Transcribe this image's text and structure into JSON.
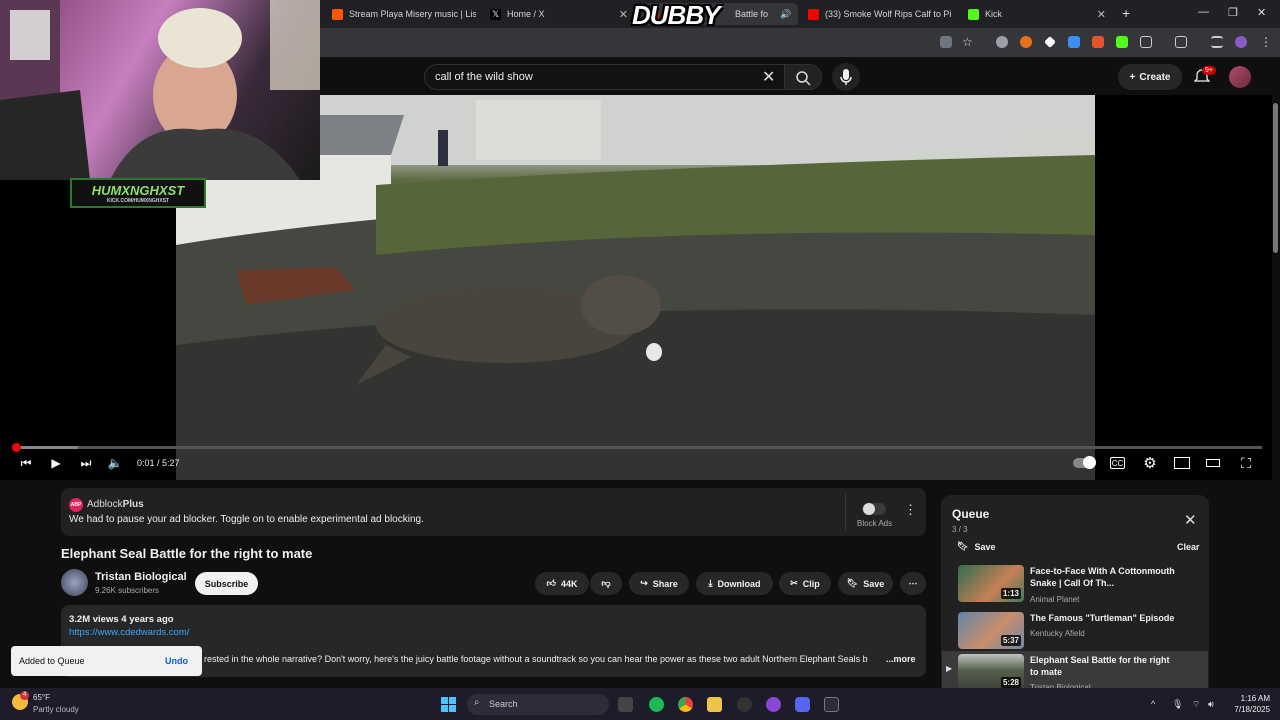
{
  "browser": {
    "tabs": [
      {
        "label": "Stream Playa Misery music | Lis",
        "favicon_color": "#ff5500",
        "active": false
      },
      {
        "label": "Home / X",
        "favicon_color": "#000000",
        "active": false
      },
      {
        "label": "Battle fo",
        "favicon_color": "#ff0000",
        "active": true
      },
      {
        "label": "(33) Smoke Wolf Rips Calf to Pi",
        "favicon_color": "#ff0000",
        "active": false
      },
      {
        "label": "Kick",
        "favicon_color": "#53fc18",
        "active": false
      }
    ],
    "new_tab": "+",
    "window_controls": {
      "minimize": "—",
      "restore": "❐",
      "close": "✕"
    }
  },
  "overlay": {
    "brand": "DUBBY",
    "streamer_tag": "HUMXNGHXST",
    "streamer_tag_sub": "KICK.COM/HUMXNGHXST"
  },
  "youtube": {
    "search_value": "call of the wild show",
    "create_label": "Create",
    "notif_badge": "9+",
    "player": {
      "time": "0:01 / 5:27",
      "progress_fraction": 0.003,
      "buffered_fraction": 0.053
    },
    "adblock": {
      "brand_prefix": "Adblock",
      "brand_suffix": "Plus",
      "logo": "ABP",
      "message": "We had to pause your ad blocker. Toggle on to enable experimental ad blocking.",
      "toggle_label": "Block Ads"
    },
    "video": {
      "title": "Elephant Seal Battle for the right to mate",
      "channel": "Tristan Biological",
      "subscribers": "9.26K subscribers",
      "subscribe_label": "Subscribe",
      "likes": "44K",
      "share_label": "Share",
      "download_label": "Download",
      "clip_label": "Clip",
      "save_label": "Save",
      "views_date": "3.2M views  4 years ago",
      "link": "https://www.cdedwards.com/",
      "description_snippet": "rested in the whole narrative? Don't worry, here's the juicy battle footage without a soundtrack so you can hear the power as these two adult Northern Elephant Seals b",
      "more_label": "...more"
    },
    "toast": {
      "message": "Added to Queue",
      "undo": "Undo"
    },
    "queue": {
      "title": "Queue",
      "count": "3 / 3",
      "save_label": "Save",
      "clear_label": "Clear",
      "items": [
        {
          "title": "Face-to-Face With A Cottonmouth Snake | Call Of Th...",
          "channel": "Animal Planet",
          "duration": "1:13",
          "thumb_color": "#3d7a5c"
        },
        {
          "title": "The Famous \"Turtleman\" Episode",
          "channel": "Kentucky Afield",
          "duration": "5:37",
          "thumb_color": "#6b8aa8"
        },
        {
          "title": "Elephant Seal Battle for the right to mate",
          "channel": "Tristan Biological",
          "duration": "5:28",
          "thumb_color": "#55604a"
        }
      ]
    }
  },
  "taskbar": {
    "weather_temp": "65°F",
    "weather_desc": "Partly cloudy",
    "weather_badge": "4",
    "search_placeholder": "Search",
    "time": "1:16 AM",
    "date": "7/18/2025"
  }
}
